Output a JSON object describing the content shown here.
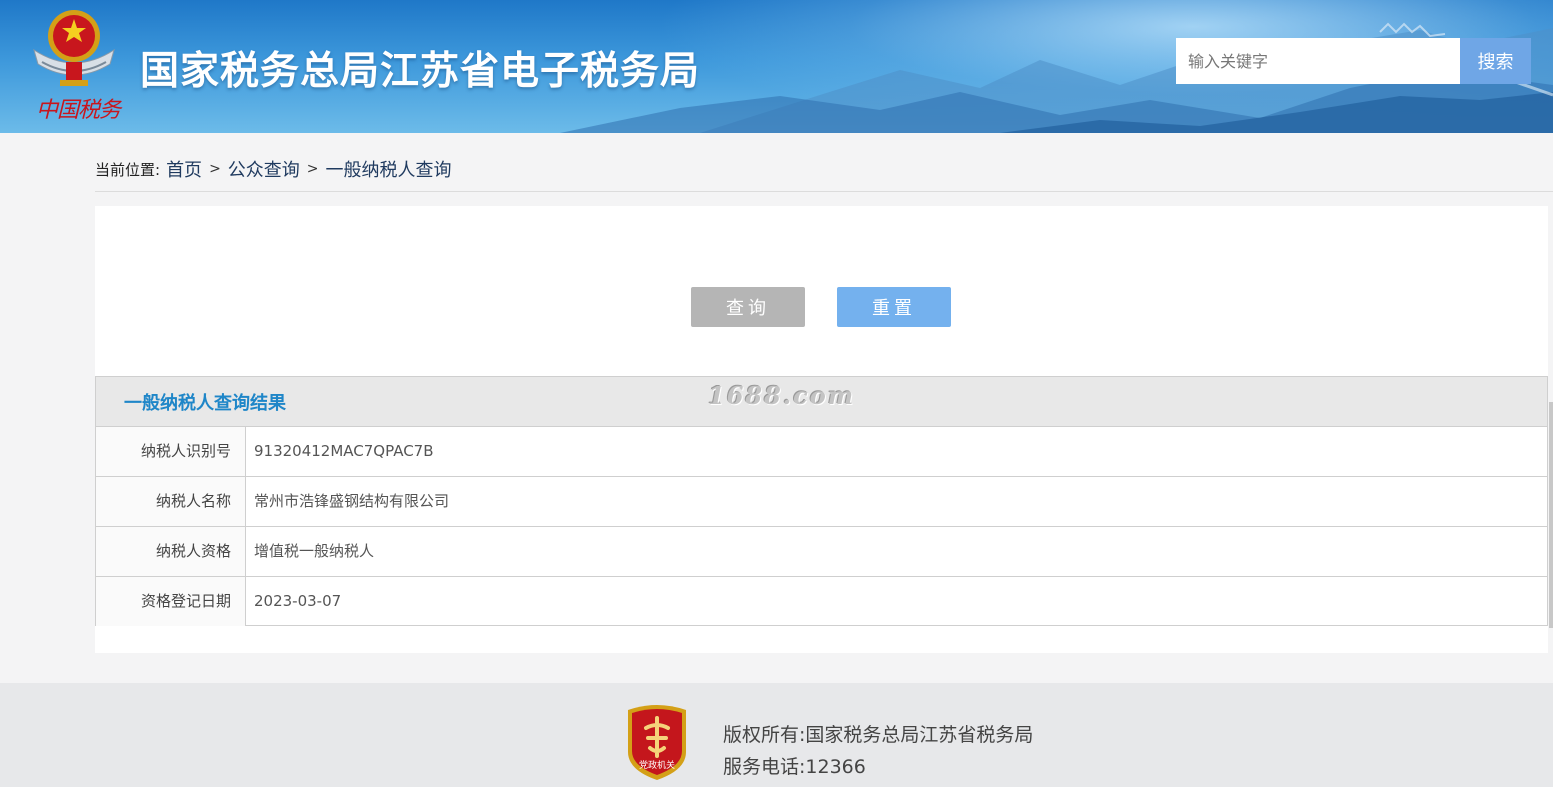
{
  "header": {
    "title": "国家税务总局江苏省电子税务局",
    "emblem_text": "中国税务",
    "search": {
      "placeholder": "输入关键字",
      "button_label": "搜索"
    }
  },
  "breadcrumb": {
    "prefix": "当前位置:",
    "items": [
      "首页",
      "公众查询",
      "一般纳税人查询"
    ],
    "separator": ">"
  },
  "actions": {
    "query_label": "查询",
    "reset_label": "重置"
  },
  "result": {
    "title": "一般纳税人查询结果",
    "watermark": "1688.com",
    "rows": [
      {
        "label": "纳税人识别号",
        "value": "91320412MAC7QPAC7B"
      },
      {
        "label": "纳税人名称",
        "value": "常州市浩锋盛钢结构有限公司"
      },
      {
        "label": "纳税人资格",
        "value": "增值税一般纳税人"
      },
      {
        "label": "资格登记日期",
        "value": "2023-03-07"
      }
    ]
  },
  "footer": {
    "badge_text": "党政机关",
    "copyright": "版权所有:国家税务总局江苏省税务局",
    "phone": "服务电话:12366"
  },
  "colors": {
    "header_blue": "#2a86d0",
    "search_button": "#6fa6e6",
    "query_button": "#b5b5b5",
    "reset_button": "#74b1ee",
    "result_title": "#1f86c8",
    "emblem_red": "#c8161d"
  }
}
